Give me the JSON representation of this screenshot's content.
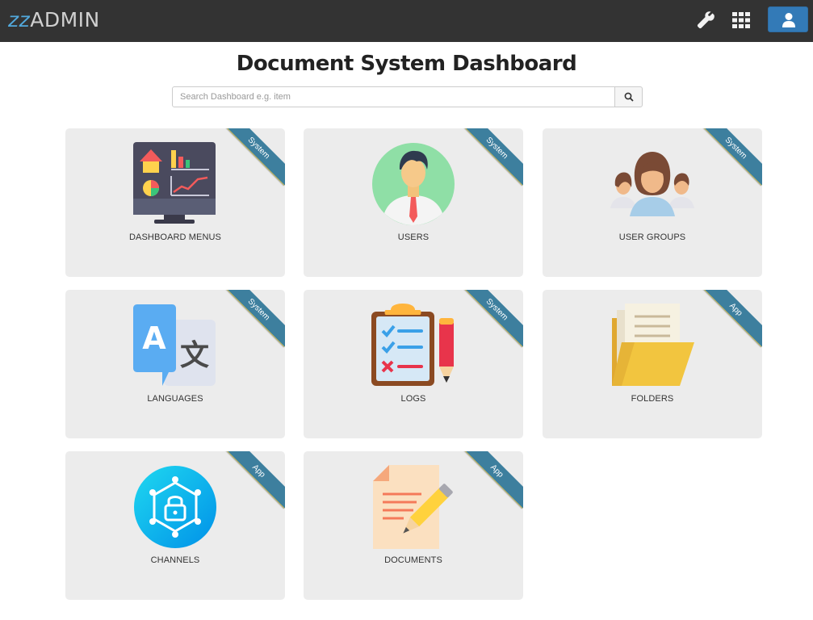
{
  "header": {
    "logo_mark": "zz",
    "logo_text": "ADMIN",
    "wrench_icon": "wrench-icon",
    "apps_icon": "grid-icon",
    "user_icon": "user-icon"
  },
  "page": {
    "title": "Document System Dashboard"
  },
  "search": {
    "placeholder": "Search Dashboard e.g. item",
    "value": "",
    "button_icon": "search-icon"
  },
  "tiles": [
    {
      "label": "DASHBOARD MENUS",
      "ribbon": "System",
      "icon": "dashboard-monitor-icon"
    },
    {
      "label": "USERS",
      "ribbon": "System",
      "icon": "user-avatar-icon"
    },
    {
      "label": "USER GROUPS",
      "ribbon": "System",
      "icon": "user-group-icon"
    },
    {
      "label": "LANGUAGES",
      "ribbon": "System",
      "icon": "translate-icon"
    },
    {
      "label": "LOGS",
      "ribbon": "System",
      "icon": "checklist-icon"
    },
    {
      "label": "FOLDERS",
      "ribbon": "App",
      "icon": "folder-icon"
    },
    {
      "label": "CHANNELS",
      "ribbon": "App",
      "icon": "network-lock-icon"
    },
    {
      "label": "DOCUMENTS",
      "ribbon": "App",
      "icon": "document-edit-icon"
    }
  ],
  "colors": {
    "topbar": "#333333",
    "accent": "#337ab7",
    "ribbon": "#3d7f9e",
    "tile_bg": "#ececec"
  }
}
